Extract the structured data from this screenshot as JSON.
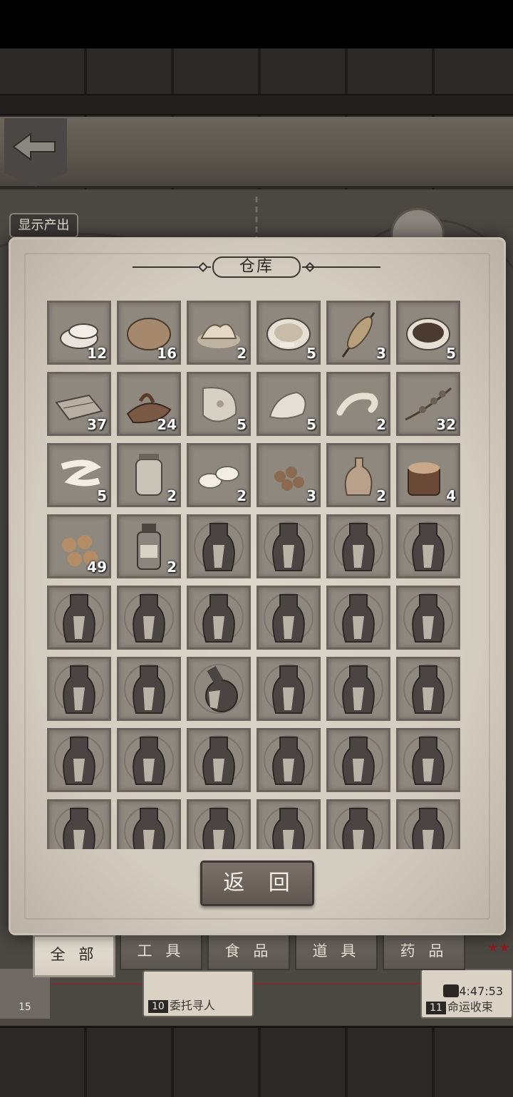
{
  "panel": {
    "title": "仓库"
  },
  "header": {
    "show_output_label": "显示产出"
  },
  "return_label": "返 回",
  "tabs": [
    {
      "label": "全 部",
      "active": true
    },
    {
      "label": "工 具",
      "active": false
    },
    {
      "label": "食 品",
      "active": false
    },
    {
      "label": "道 具",
      "active": false
    },
    {
      "label": "药 品",
      "active": false
    }
  ],
  "map": {
    "quest1": {
      "num": "10",
      "label": "委托寻人"
    },
    "quest2": {
      "num": "11",
      "label": "命运收束"
    },
    "timer": "4:47:53",
    "left_card_num": "15",
    "stars": "★★"
  },
  "items": [
    {
      "icon": "noodle-icon",
      "count": "12"
    },
    {
      "icon": "potato-icon",
      "count": "16"
    },
    {
      "icon": "mash-icon",
      "count": "2"
    },
    {
      "icon": "soup-bowl-icon",
      "count": "5"
    },
    {
      "icon": "corn-skewer-icon",
      "count": "3"
    },
    {
      "icon": "stew-bowl-icon",
      "count": "5"
    },
    {
      "icon": "jerky-icon",
      "count": "37"
    },
    {
      "icon": "mushroom-icon",
      "count": "24"
    },
    {
      "icon": "fish-steak-icon",
      "count": "5"
    },
    {
      "icon": "chicken-icon",
      "count": "5"
    },
    {
      "icon": "shrimp-icon",
      "count": "2"
    },
    {
      "icon": "herb-icon",
      "count": "32"
    },
    {
      "icon": "ribbon-icon",
      "count": "5"
    },
    {
      "icon": "jar-icon",
      "count": "2"
    },
    {
      "icon": "pebbles-icon",
      "count": "2"
    },
    {
      "icon": "nuts-icon",
      "count": "3"
    },
    {
      "icon": "spice-pot-icon",
      "count": "2"
    },
    {
      "icon": "bread-log-icon",
      "count": "4"
    },
    {
      "icon": "balls-icon",
      "count": "49"
    },
    {
      "icon": "bottle-icon",
      "count": "2"
    },
    {
      "icon": "potion-icon",
      "count": ""
    },
    {
      "icon": "potion-icon",
      "count": ""
    },
    {
      "icon": "potion-icon",
      "count": ""
    },
    {
      "icon": "potion-icon",
      "count": ""
    },
    {
      "icon": "potion-icon",
      "count": ""
    },
    {
      "icon": "potion-icon",
      "count": ""
    },
    {
      "icon": "potion-icon",
      "count": ""
    },
    {
      "icon": "potion-icon",
      "count": ""
    },
    {
      "icon": "potion-icon",
      "count": ""
    },
    {
      "icon": "potion-icon",
      "count": ""
    },
    {
      "icon": "potion-icon",
      "count": ""
    },
    {
      "icon": "potion-icon",
      "count": ""
    },
    {
      "icon": "round-potion-icon",
      "count": ""
    },
    {
      "icon": "potion-icon",
      "count": ""
    },
    {
      "icon": "potion-icon",
      "count": ""
    },
    {
      "icon": "potion-icon",
      "count": ""
    },
    {
      "icon": "potion-icon",
      "count": ""
    },
    {
      "icon": "potion-icon",
      "count": ""
    },
    {
      "icon": "potion-icon",
      "count": ""
    },
    {
      "icon": "potion-icon",
      "count": ""
    },
    {
      "icon": "potion-icon",
      "count": ""
    },
    {
      "icon": "potion-icon",
      "count": ""
    },
    {
      "icon": "potion-icon",
      "count": ""
    },
    {
      "icon": "potion-icon",
      "count": ""
    },
    {
      "icon": "potion-icon",
      "count": ""
    },
    {
      "icon": "potion-icon",
      "count": ""
    },
    {
      "icon": "potion-icon",
      "count": ""
    },
    {
      "icon": "potion-icon",
      "count": ""
    }
  ]
}
